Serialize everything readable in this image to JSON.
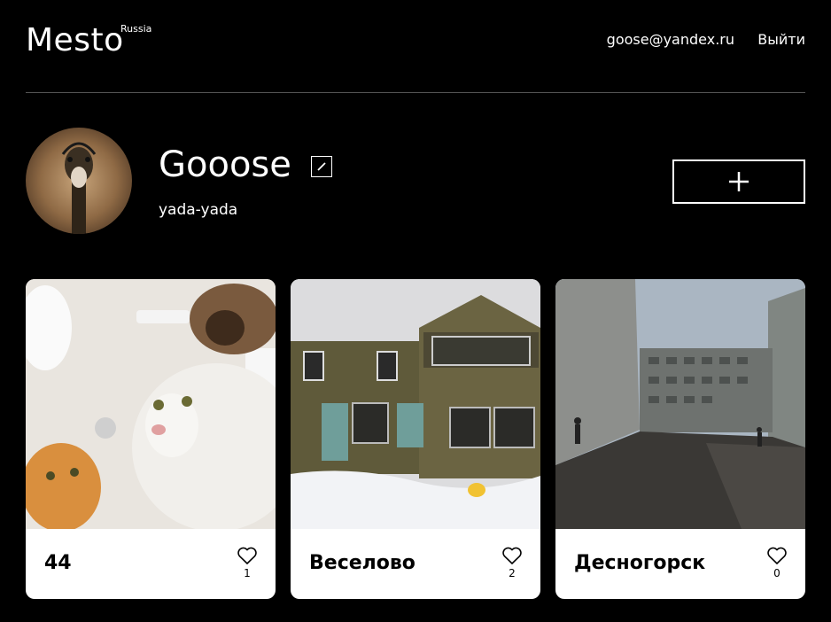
{
  "header": {
    "logo": "Mesto",
    "logo_sub": "Russia",
    "email": "goose@yandex.ru",
    "logout": "Выйти"
  },
  "profile": {
    "name": "Gooose",
    "about": "yada-yada"
  },
  "cards": [
    {
      "title": "44",
      "likes": "1"
    },
    {
      "title": "Веселово",
      "likes": "2"
    },
    {
      "title": "Десногорск",
      "likes": "0"
    }
  ]
}
